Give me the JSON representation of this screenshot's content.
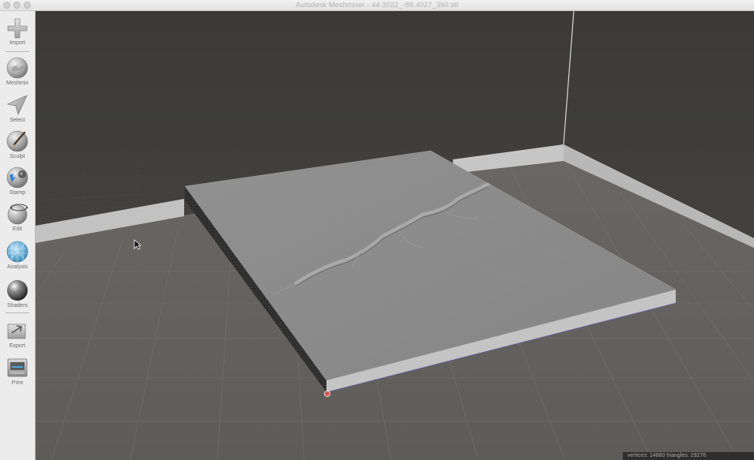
{
  "window": {
    "title": "Autodesk Meshmixer - 44.3022_-88.4027_360.stl"
  },
  "toolbar": {
    "items": [
      {
        "label": "Import",
        "icon": "plus-icon"
      },
      {
        "label": "Meshmix",
        "icon": "meshmix-sphere-icon"
      },
      {
        "label": "Select",
        "icon": "select-arrow-icon"
      },
      {
        "label": "Sculpt",
        "icon": "sculpt-brush-icon"
      },
      {
        "label": "Stamp",
        "icon": "stamp-icon"
      },
      {
        "label": "Edit",
        "icon": "edit-sphere-icon"
      },
      {
        "label": "Analysis",
        "icon": "analysis-mesh-icon"
      },
      {
        "label": "Shaders",
        "icon": "shader-ball-icon"
      },
      {
        "label": "Export",
        "icon": "export-icon"
      },
      {
        "label": "Print",
        "icon": "printer-icon"
      }
    ]
  },
  "status": {
    "text": "vertices: 14880 triangles: 29276"
  },
  "colors": {
    "titlebar": "#e8e8e8",
    "toolbar": "#ececec",
    "back_wall": "#3d3c3a",
    "floor": "#6e6c68",
    "model_top": "#8c8c8c",
    "pivot": "#e05050"
  }
}
